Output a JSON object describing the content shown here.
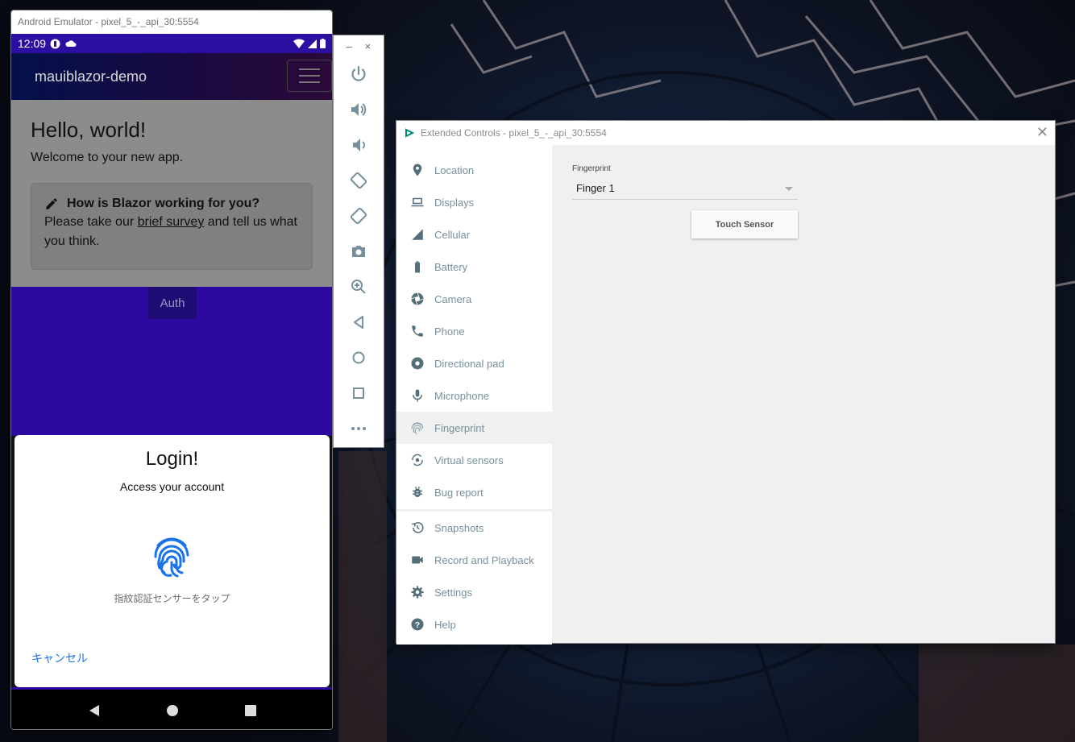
{
  "emulator": {
    "window_title": "Android Emulator - pixel_5_-_api_30:5554",
    "status_time": "12:09",
    "app_brand": "mauiblazor-demo",
    "heading": "Hello, world!",
    "welcome_text": "Welcome to your new app.",
    "survey": {
      "title": "How is Blazor working for you?",
      "text_before": "Please take our ",
      "link_text": "brief survey",
      "text_after": " and tell us what you think."
    },
    "auth_button": "Auth",
    "login_dialog": {
      "title": "Login!",
      "subtitle": "Access your account",
      "hint": "指紋認証センサーをタップ",
      "cancel": "キャンセル"
    }
  },
  "toolbar": {
    "minimize": "–",
    "close": "×",
    "buttons": [
      "power-icon",
      "volume-up-icon",
      "volume-down-icon",
      "rotate-left-icon",
      "rotate-right-icon",
      "camera-icon",
      "zoom-icon",
      "back-icon",
      "home-icon",
      "overview-icon",
      "more-icon"
    ]
  },
  "extended_controls": {
    "window_title": "Extended Controls - pixel_5_-_api_30:5554",
    "close": "✕",
    "nav": [
      {
        "label": "Location",
        "icon": "location-pin-icon"
      },
      {
        "label": "Displays",
        "icon": "laptop-icon"
      },
      {
        "label": "Cellular",
        "icon": "signal-icon"
      },
      {
        "label": "Battery",
        "icon": "battery-icon"
      },
      {
        "label": "Camera",
        "icon": "aperture-icon"
      },
      {
        "label": "Phone",
        "icon": "phone-icon"
      },
      {
        "label": "Directional pad",
        "icon": "dpad-icon"
      },
      {
        "label": "Microphone",
        "icon": "microphone-icon"
      },
      {
        "label": "Fingerprint",
        "icon": "fingerprint-icon",
        "active": true
      },
      {
        "label": "Virtual sensors",
        "icon": "rotation-icon"
      },
      {
        "label": "Bug report",
        "icon": "bug-icon"
      },
      {
        "label": "Snapshots",
        "icon": "history-icon"
      },
      {
        "label": "Record and Playback",
        "icon": "videocam-icon"
      },
      {
        "label": "Settings",
        "icon": "gear-icon"
      },
      {
        "label": "Help",
        "icon": "help-icon"
      }
    ],
    "fingerprint": {
      "label": "Fingerprint",
      "selected": "Finger 1",
      "touch_button": "Touch Sensor"
    }
  },
  "colors": {
    "status_bar": "#2c0fa0",
    "accent_link": "#1a73e8",
    "nav_text": "#78909c",
    "fingerprint_blue": "#1a73e8"
  }
}
